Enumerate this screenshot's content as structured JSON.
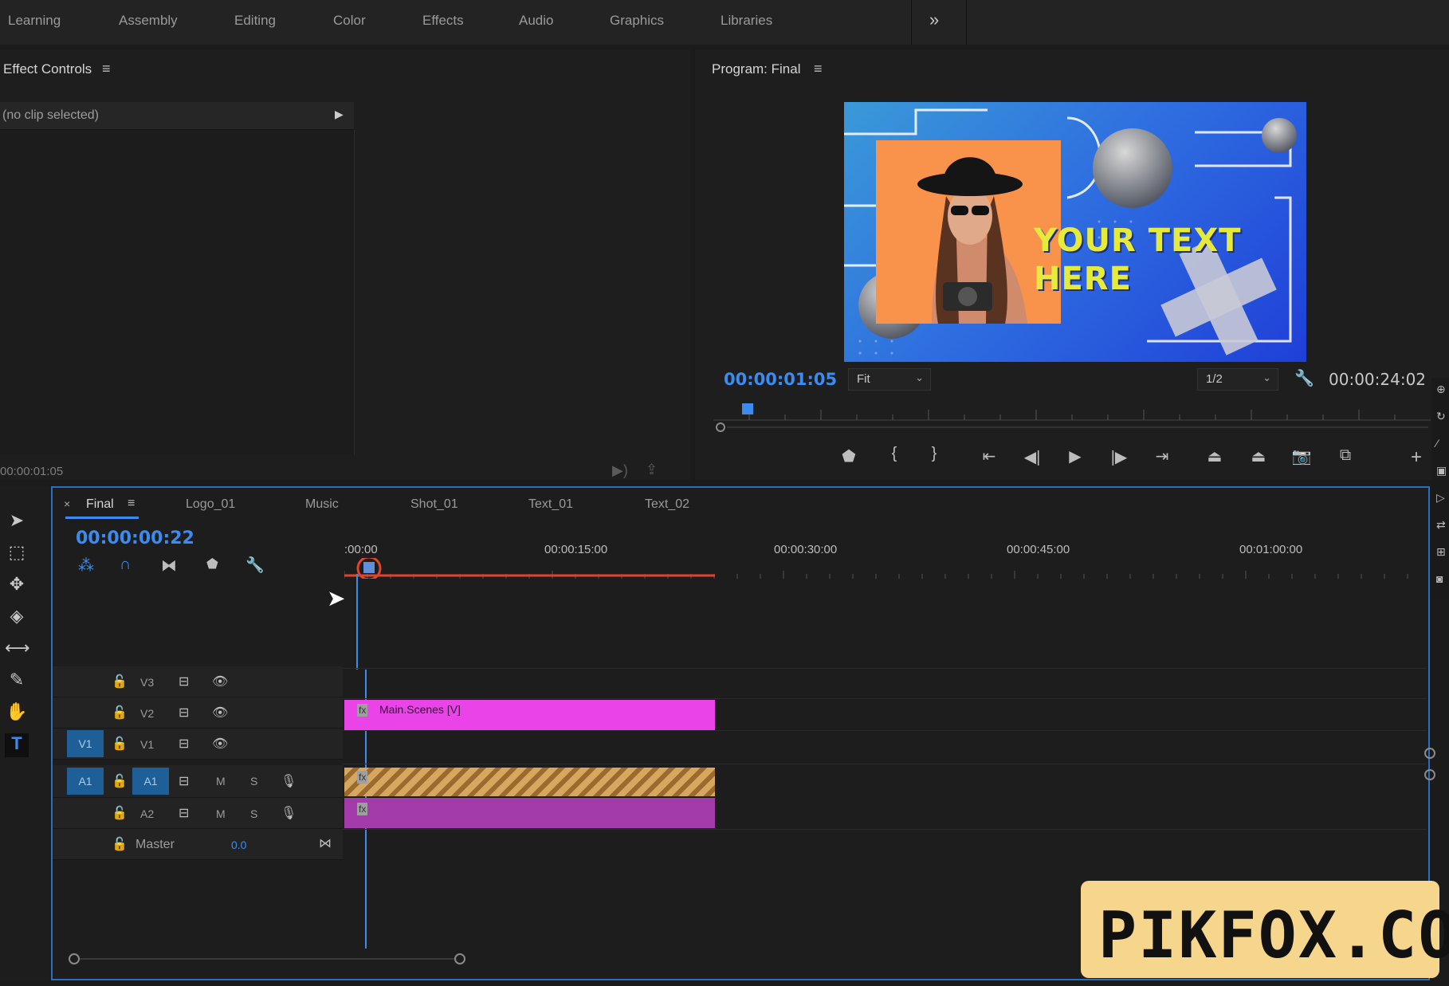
{
  "workspaces": [
    "Learning",
    "Assembly",
    "Editing",
    "Color",
    "Effects",
    "Audio",
    "Graphics",
    "Libraries"
  ],
  "workspace_more": "»",
  "effect_controls": {
    "title": "Effect Controls",
    "menu": "≡",
    "clip": "(no clip selected)",
    "timecode": "00:00:01:05"
  },
  "program": {
    "title": "Program: Final",
    "menu": "≡",
    "timecode": "00:00:01:05",
    "fit": "Fit",
    "resolution": "1/2",
    "duration": "00:00:24:02",
    "video_text_line1": "YOUR TEXT",
    "video_text_line2": "HERE",
    "video_colors": {
      "text": "#e6ea3a",
      "photo_bg": "#f9924a"
    }
  },
  "timeline": {
    "close": "×",
    "menu": "≡",
    "tabs": [
      "Final",
      "Logo_01",
      "Music",
      "Shot_01",
      "Text_01",
      "Text_02"
    ],
    "timecode": "00:00:00:22",
    "ruler": [
      ":00:00",
      "00:00:15:00",
      "00:00:30:00",
      "00:00:45:00",
      "00:01:00:00"
    ],
    "tracks": {
      "v3": "V3",
      "v2": "V2",
      "v1": "V1",
      "a1": "A1",
      "a2": "A2",
      "master": "Master",
      "master_value": "0.0",
      "mute": "M",
      "solo": "S"
    },
    "clip_v2": "Main.Scenes [V]",
    "fx": "fx"
  },
  "watermark": "PIKFOX.COM"
}
